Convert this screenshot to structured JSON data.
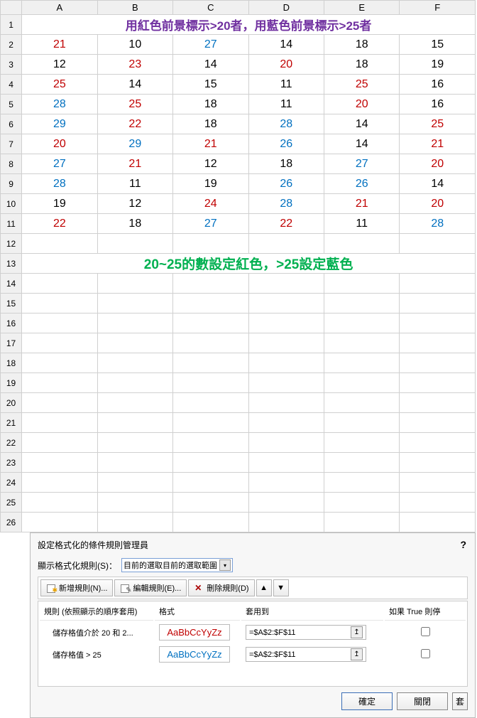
{
  "columns": [
    "A",
    "B",
    "C",
    "D",
    "E",
    "F"
  ],
  "rows": [
    "1",
    "2",
    "3",
    "4",
    "5",
    "6",
    "7",
    "8",
    "9",
    "10",
    "11",
    "12",
    "13",
    "14",
    "15",
    "16",
    "17",
    "18",
    "19",
    "20",
    "21",
    "22",
    "23",
    "24",
    "25",
    "26"
  ],
  "title": "用紅色前景標示>20者，用藍色前景標示>25者",
  "summary": "20~25的數設定紅色，>25設定藍色",
  "grid": [
    [
      {
        "v": "21",
        "c": "red"
      },
      {
        "v": "10",
        "c": "black"
      },
      {
        "v": "27",
        "c": "blue"
      },
      {
        "v": "14",
        "c": "black"
      },
      {
        "v": "18",
        "c": "black"
      },
      {
        "v": "15",
        "c": "black"
      }
    ],
    [
      {
        "v": "12",
        "c": "black"
      },
      {
        "v": "23",
        "c": "red"
      },
      {
        "v": "14",
        "c": "black"
      },
      {
        "v": "20",
        "c": "red"
      },
      {
        "v": "18",
        "c": "black"
      },
      {
        "v": "19",
        "c": "black"
      }
    ],
    [
      {
        "v": "25",
        "c": "red"
      },
      {
        "v": "14",
        "c": "black"
      },
      {
        "v": "15",
        "c": "black"
      },
      {
        "v": "11",
        "c": "black"
      },
      {
        "v": "25",
        "c": "red"
      },
      {
        "v": "16",
        "c": "black"
      }
    ],
    [
      {
        "v": "28",
        "c": "blue"
      },
      {
        "v": "25",
        "c": "red"
      },
      {
        "v": "18",
        "c": "black"
      },
      {
        "v": "11",
        "c": "black"
      },
      {
        "v": "20",
        "c": "red"
      },
      {
        "v": "16",
        "c": "black"
      }
    ],
    [
      {
        "v": "29",
        "c": "blue"
      },
      {
        "v": "22",
        "c": "red"
      },
      {
        "v": "18",
        "c": "black"
      },
      {
        "v": "28",
        "c": "blue"
      },
      {
        "v": "14",
        "c": "black"
      },
      {
        "v": "25",
        "c": "red"
      }
    ],
    [
      {
        "v": "20",
        "c": "red"
      },
      {
        "v": "29",
        "c": "blue"
      },
      {
        "v": "21",
        "c": "red"
      },
      {
        "v": "26",
        "c": "blue"
      },
      {
        "v": "14",
        "c": "black"
      },
      {
        "v": "21",
        "c": "red"
      }
    ],
    [
      {
        "v": "27",
        "c": "blue"
      },
      {
        "v": "21",
        "c": "red"
      },
      {
        "v": "12",
        "c": "black"
      },
      {
        "v": "18",
        "c": "black"
      },
      {
        "v": "27",
        "c": "blue"
      },
      {
        "v": "20",
        "c": "red"
      }
    ],
    [
      {
        "v": "28",
        "c": "blue"
      },
      {
        "v": "11",
        "c": "black"
      },
      {
        "v": "19",
        "c": "black"
      },
      {
        "v": "26",
        "c": "blue"
      },
      {
        "v": "26",
        "c": "blue"
      },
      {
        "v": "14",
        "c": "black"
      }
    ],
    [
      {
        "v": "19",
        "c": "black"
      },
      {
        "v": "12",
        "c": "black"
      },
      {
        "v": "24",
        "c": "red"
      },
      {
        "v": "28",
        "c": "blue"
      },
      {
        "v": "21",
        "c": "red"
      },
      {
        "v": "20",
        "c": "red"
      }
    ],
    [
      {
        "v": "22",
        "c": "red"
      },
      {
        "v": "18",
        "c": "black"
      },
      {
        "v": "27",
        "c": "blue"
      },
      {
        "v": "22",
        "c": "red"
      },
      {
        "v": "11",
        "c": "black"
      },
      {
        "v": "28",
        "c": "blue"
      }
    ]
  ],
  "dialog": {
    "title": "設定格式化的條件規則管理員",
    "help": "?",
    "show_label": "顯示格式化規則(S)：",
    "show_value": "目前的選取目前的選取範圍",
    "btn_new": "新增規則(N)...",
    "btn_edit": "編輯規則(E)...",
    "btn_delete": "刪除規則(D)",
    "arrow_up": "▲",
    "arrow_down": "▼",
    "col_rule": "規則 (依照顯示的順序套用)",
    "col_format": "格式",
    "col_applies": "套用到",
    "col_stop": "如果 True 則停",
    "sample": "AaBbCcYyZz",
    "rules": [
      {
        "name": "儲存格值介於 20 和 2...",
        "color": "#c00000",
        "applies": "=$A$2:$F$11"
      },
      {
        "name": "儲存格值 > 25",
        "color": "#0070c0",
        "applies": "=$A$2:$F$11"
      }
    ],
    "ok": "確定",
    "close": "關閉",
    "apply": "套"
  }
}
